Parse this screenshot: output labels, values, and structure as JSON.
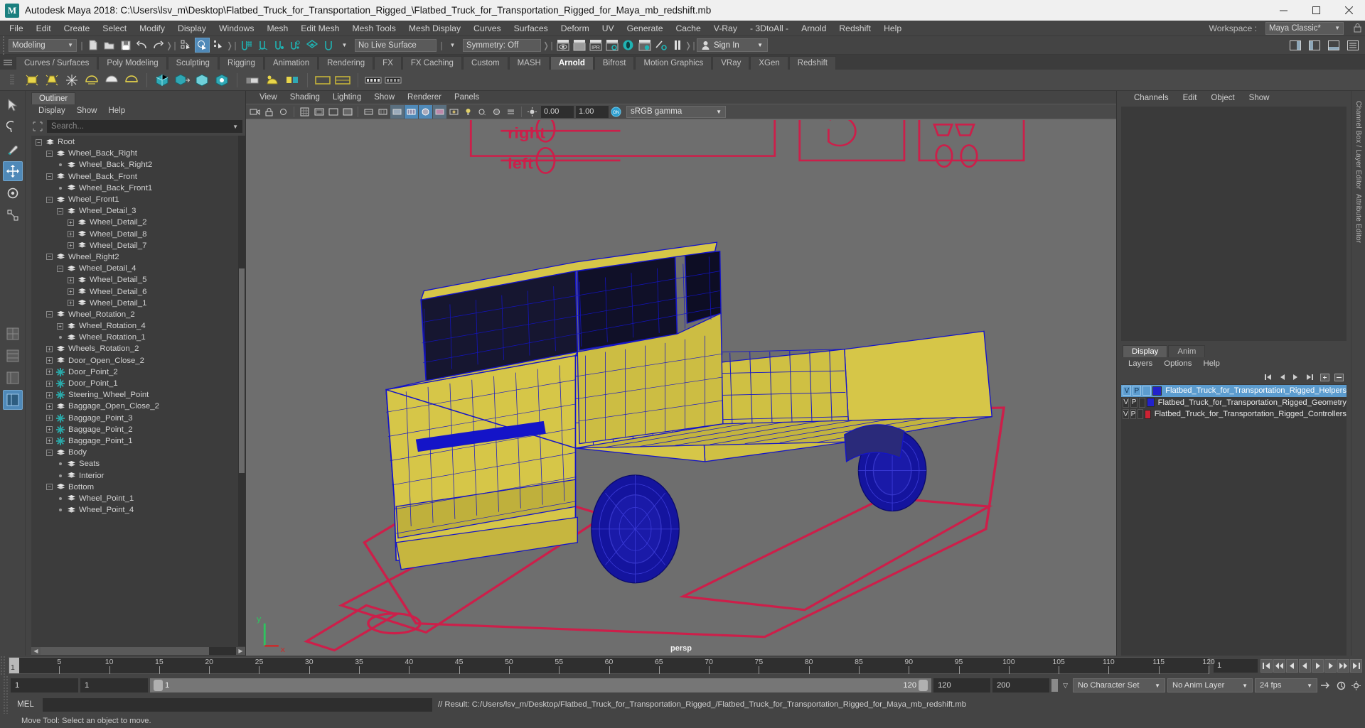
{
  "window": {
    "title": "Autodesk Maya 2018: C:\\Users\\lsv_m\\Desktop\\Flatbed_Truck_for_Transportation_Rigged_\\Flatbed_Truck_for_Transportation_Rigged_for_Maya_mb_redshift.mb",
    "app_initial": "M",
    "minimize": "—",
    "maximize": "☐",
    "close": "✕"
  },
  "menubar": {
    "items": [
      "File",
      "Edit",
      "Create",
      "Select",
      "Modify",
      "Display",
      "Windows",
      "Mesh",
      "Edit Mesh",
      "Mesh Tools",
      "Mesh Display",
      "Curves",
      "Surfaces",
      "Deform",
      "UV",
      "Generate",
      "Cache",
      "V-Ray",
      "- 3DtoAll -",
      "Arnold",
      "Redshift",
      "Help"
    ]
  },
  "statusbar": {
    "menuset": "Modeling",
    "live_surface": "No Live Surface",
    "symmetry": "Symmetry: Off",
    "signin": "Sign In",
    "workspace_label": "Workspace :",
    "workspace_value": "Maya Classic*"
  },
  "shelf": {
    "tabs": [
      "Curves / Surfaces",
      "Poly Modeling",
      "Sculpting",
      "Rigging",
      "Animation",
      "Rendering",
      "FX",
      "FX Caching",
      "Custom",
      "MASH",
      "Arnold",
      "Bifrost",
      "Motion Graphics",
      "VRay",
      "XGen",
      "Redshift"
    ],
    "active_tab": "Arnold"
  },
  "outliner": {
    "tab": "Outliner",
    "menu": [
      "Display",
      "Show",
      "Help"
    ],
    "search_placeholder": "Search...",
    "rows": [
      {
        "label": "Root",
        "depth": 0,
        "toggle": "minus",
        "icon": "transform"
      },
      {
        "label": "Wheel_Back_Right",
        "depth": 1,
        "toggle": "minus",
        "icon": "transform"
      },
      {
        "label": "Wheel_Back_Right2",
        "depth": 2,
        "toggle": "dot",
        "icon": "transform"
      },
      {
        "label": "Wheel_Back_Front",
        "depth": 1,
        "toggle": "minus",
        "icon": "transform"
      },
      {
        "label": "Wheel_Back_Front1",
        "depth": 2,
        "toggle": "dot",
        "icon": "transform"
      },
      {
        "label": "Wheel_Front1",
        "depth": 1,
        "toggle": "minus",
        "icon": "transform"
      },
      {
        "label": "Wheel_Detail_3",
        "depth": 2,
        "toggle": "minus",
        "icon": "transform"
      },
      {
        "label": "Wheel_Detail_2",
        "depth": 3,
        "toggle": "plus",
        "icon": "transform"
      },
      {
        "label": "Wheel_Detail_8",
        "depth": 3,
        "toggle": "plus",
        "icon": "transform"
      },
      {
        "label": "Wheel_Detail_7",
        "depth": 3,
        "toggle": "plus",
        "icon": "transform"
      },
      {
        "label": "Wheel_Right2",
        "depth": 1,
        "toggle": "minus",
        "icon": "transform"
      },
      {
        "label": "Wheel_Detail_4",
        "depth": 2,
        "toggle": "minus",
        "icon": "transform"
      },
      {
        "label": "Wheel_Detail_5",
        "depth": 3,
        "toggle": "plus",
        "icon": "transform"
      },
      {
        "label": "Wheel_Detail_6",
        "depth": 3,
        "toggle": "plus",
        "icon": "transform"
      },
      {
        "label": "Wheel_Detail_1",
        "depth": 3,
        "toggle": "plus",
        "icon": "transform"
      },
      {
        "label": "Wheel_Rotation_2",
        "depth": 1,
        "toggle": "minus",
        "icon": "transform"
      },
      {
        "label": "Wheel_Rotation_4",
        "depth": 2,
        "toggle": "plus",
        "icon": "transform"
      },
      {
        "label": "Wheel_Rotation_1",
        "depth": 2,
        "toggle": "dot",
        "icon": "transform"
      },
      {
        "label": "Wheels_Rotation_2",
        "depth": 1,
        "toggle": "plus",
        "icon": "transform"
      },
      {
        "label": "Door_Open_Close_2",
        "depth": 1,
        "toggle": "plus",
        "icon": "transform"
      },
      {
        "label": "Door_Point_2",
        "depth": 1,
        "toggle": "plus",
        "icon": "locator"
      },
      {
        "label": "Door_Point_1",
        "depth": 1,
        "toggle": "plus",
        "icon": "locator"
      },
      {
        "label": "Steering_Wheel_Point",
        "depth": 1,
        "toggle": "plus",
        "icon": "locator"
      },
      {
        "label": "Baggage_Open_Close_2",
        "depth": 1,
        "toggle": "plus",
        "icon": "transform"
      },
      {
        "label": "Baggage_Point_3",
        "depth": 1,
        "toggle": "plus",
        "icon": "locator"
      },
      {
        "label": "Baggage_Point_2",
        "depth": 1,
        "toggle": "plus",
        "icon": "locator"
      },
      {
        "label": "Baggage_Point_1",
        "depth": 1,
        "toggle": "plus",
        "icon": "locator"
      },
      {
        "label": "Body",
        "depth": 1,
        "toggle": "minus",
        "icon": "transform"
      },
      {
        "label": "Seats",
        "depth": 2,
        "toggle": "dot",
        "icon": "transform"
      },
      {
        "label": "Interior",
        "depth": 2,
        "toggle": "dot",
        "icon": "transform"
      },
      {
        "label": "Bottom",
        "depth": 1,
        "toggle": "minus",
        "icon": "transform"
      },
      {
        "label": "Wheel_Point_1",
        "depth": 2,
        "toggle": "dot",
        "icon": "transform"
      },
      {
        "label": "Wheel_Point_4",
        "depth": 2,
        "toggle": "dot",
        "icon": "transform"
      }
    ]
  },
  "viewport": {
    "menu": [
      "View",
      "Shading",
      "Lighting",
      "Show",
      "Renderer",
      "Panels"
    ],
    "exposure": "0.00",
    "gamma_value": "1.00",
    "color_mgmt": "sRGB gamma",
    "camera_label": "persp"
  },
  "right_panel": {
    "tabs": [
      "Channels",
      "Edit",
      "Object",
      "Show"
    ],
    "side_label_channelbox": "Channel Box / Layer Editor",
    "side_label_attreditor": "Attribute Editor",
    "display_tabs": [
      "Display",
      "Anim"
    ],
    "active_display_tab": "Display",
    "layer_menu": [
      "Layers",
      "Options",
      "Help"
    ],
    "layers": [
      {
        "v": "V",
        "p": "P",
        "color": "#2222cc",
        "name": "Flatbed_Truck_for_Transportation_Rigged_Helpers",
        "selected": true
      },
      {
        "v": "V",
        "p": "P",
        "color": "#2222cc",
        "name": "Flatbed_Truck_for_Transportation_Rigged_Geometry",
        "selected": false
      },
      {
        "v": "V",
        "p": "P",
        "color": "#cc2233",
        "name": "Flatbed_Truck_for_Transportation_Rigged_Controllers",
        "selected": false
      }
    ]
  },
  "timeline": {
    "current_frame": "1",
    "ticks": [
      5,
      10,
      15,
      20,
      25,
      30,
      35,
      40,
      45,
      50,
      55,
      60,
      65,
      70,
      75,
      80,
      85,
      90,
      95,
      100,
      105,
      110,
      115,
      120
    ],
    "frame_field": "1"
  },
  "range": {
    "start_field": "1",
    "anim_start": "1",
    "slider_start": "1",
    "slider_end": "120",
    "range_end": "120",
    "anim_end": "200",
    "character_set": "No Character Set",
    "anim_layer": "No Anim Layer",
    "fps": "24 fps"
  },
  "command_line": {
    "label": "MEL",
    "input_value": "",
    "result": "// Result: C:/Users/lsv_m/Desktop/Flatbed_Truck_for_Transportation_Rigged_/Flatbed_Truck_for_Transportation_Rigged_for_Maya_mb_redshift.mb"
  },
  "status_help": "Move Tool: Select an object to move.",
  "colors": {
    "accent_blue": "#4f89b8",
    "teal": "#1fb3b3",
    "body_yellow": "#d6c648",
    "wire_blue": "#1414c8",
    "control_red": "#cc1f4a",
    "viewport_bg": "#6e6e6e"
  }
}
